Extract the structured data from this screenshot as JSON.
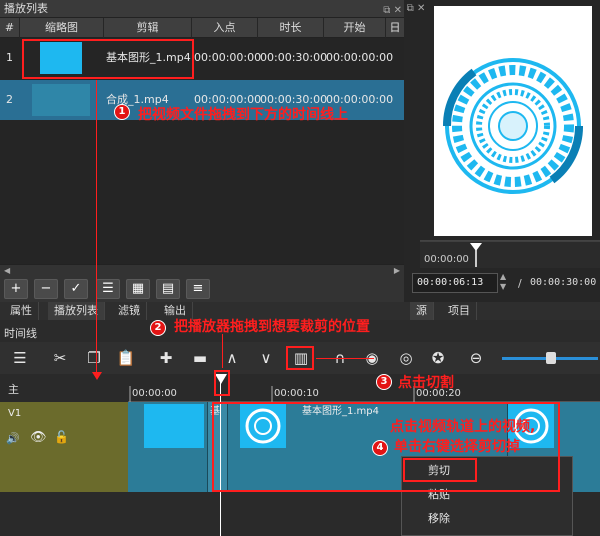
{
  "playlist": {
    "title": "播放列表",
    "columns": [
      "#",
      "缩略图",
      "剪辑",
      "入点",
      "时长",
      "开始",
      "日"
    ],
    "rows": [
      {
        "num": "1",
        "clip": "基本图形_1.mp4",
        "in": "00:00:00:00",
        "duration": "00:00:30:00",
        "start": "00:00:00:00"
      },
      {
        "num": "2",
        "clip": "合成_1.mp4",
        "in": "00:00:00:00",
        "duration": "00:00:30:00",
        "start": "00:00:00:00"
      }
    ],
    "tabs": [
      "属性",
      "播放列表",
      "滤镜",
      "输出"
    ]
  },
  "preview": {
    "ruler_time": "00:00:00",
    "current_time": "00:00:06:13",
    "separator": "/",
    "total_time": "00:00:30:00",
    "tabs": [
      "源",
      "项目"
    ]
  },
  "timeline": {
    "title": "时间线",
    "track_main": "主",
    "track_v1": "V1",
    "ruler_ticks": [
      "00:00:00",
      "00:00:10",
      "00:00:20"
    ],
    "clip_labels": [
      "基",
      "基本图形_1.mp4"
    ]
  },
  "context_menu": {
    "items": [
      "剪切",
      "粘贴",
      "移除"
    ]
  },
  "annotations": {
    "step1": "把视频文件拖拽到下方的时间线上",
    "step2": "把播放器拖拽到想要裁剪的位置",
    "step3": "点击切割",
    "step4_line1": "点击视频轨道上的视频,",
    "step4_line2": "单击右键选择剪切掉",
    "badges": [
      "1",
      "2",
      "3",
      "4"
    ]
  },
  "colors": {
    "annotation": "#ff1e1e",
    "selected_row": "#2a6f94",
    "track": "#2c6e86",
    "track_head": "#6b6b2c",
    "thumb_cyan": "#1eb8f0"
  }
}
